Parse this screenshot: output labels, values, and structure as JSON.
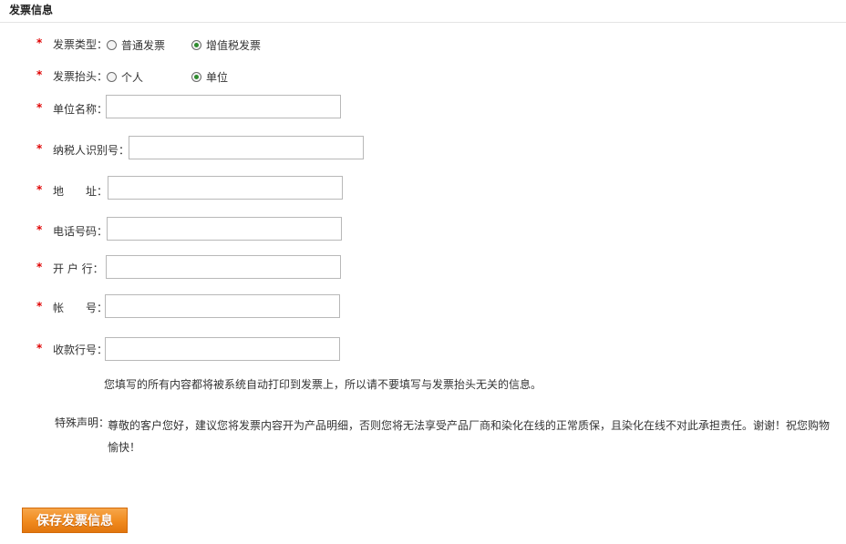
{
  "section": {
    "title": "发票信息"
  },
  "required_mark": "*",
  "invoice_type": {
    "label": "发票类型：",
    "options": [
      {
        "label": "普通发票",
        "checked": false
      },
      {
        "label": "增值税发票",
        "checked": true
      }
    ]
  },
  "invoice_header": {
    "label": "发票抬头：",
    "options": [
      {
        "label": "个人",
        "checked": false
      },
      {
        "label": "单位",
        "checked": true
      }
    ]
  },
  "fields": {
    "company_name": {
      "label": "单位名称：",
      "value": ""
    },
    "tax_id": {
      "label": "纳税人识别号：",
      "value": ""
    },
    "address": {
      "label": "地　　址：",
      "value": ""
    },
    "phone": {
      "label": "电话号码：",
      "value": ""
    },
    "bank": {
      "label": "开 户 行：",
      "value": ""
    },
    "account": {
      "label": "帐　　号：",
      "value": ""
    },
    "bank_code": {
      "label": "收款行号：",
      "value": ""
    }
  },
  "notice": "您填写的所有内容都将被系统自动打印到发票上，所以请不要填写与发票抬头无关的信息。",
  "declaration": {
    "label": "特殊声明：",
    "text": "尊敬的客户您好，建议您将发票内容开为产品明细，否则您将无法享受产品厂商和染化在线的正常质保，且染化在线不对此承担责任。谢谢！祝您购物愉快！"
  },
  "save_button": {
    "label": "保存发票信息"
  },
  "colors": {
    "required": "#e00000",
    "button": "#f08a1e",
    "radio_checked": "#2e8b2e"
  }
}
